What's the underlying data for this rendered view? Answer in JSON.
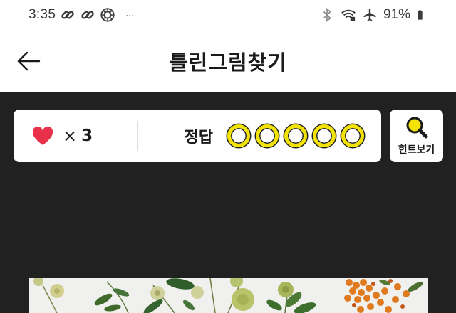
{
  "status": {
    "time": "3:35",
    "battery": "91%",
    "more": "···",
    "icons": [
      "link-icon",
      "link-icon",
      "settings-ring-icon",
      "bluetooth-icon",
      "wifi-icon",
      "airplane-icon",
      "battery-icon"
    ]
  },
  "app_bar": {
    "title": "틀린그림찾기",
    "back_icon": "arrow-left-icon"
  },
  "score": {
    "lives_icon": "heart-icon",
    "times": "×",
    "lives": "3",
    "answer_label": "정답",
    "answers_found": 0,
    "answers_total": 5,
    "circle_color": "#f2e205",
    "heart_color": "#e8304a"
  },
  "hint": {
    "label": "힌트보기",
    "icon": "magnifier-icon"
  },
  "colors": {
    "background_dark": "#212121",
    "accent_yellow": "#f2e205"
  }
}
